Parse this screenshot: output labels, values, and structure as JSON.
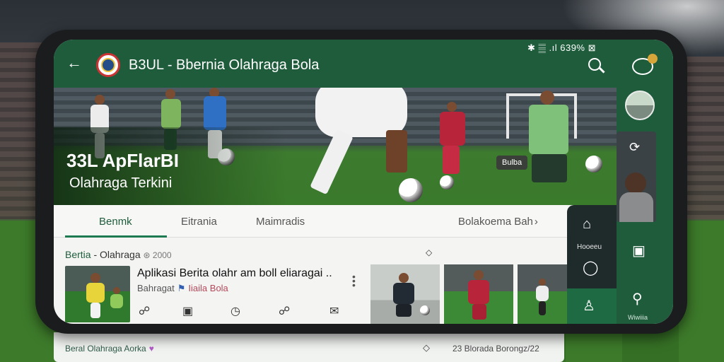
{
  "status_bar": {
    "text": "✱ 𝄛 .ıl 639% ⊠"
  },
  "app_bar": {
    "title": "B3UL - Bbernia Olahraga Bola"
  },
  "hero": {
    "title": "33L ApFlarBI",
    "subtitle": "Olahraga Terkini",
    "badge": "Bulba"
  },
  "tabs": [
    {
      "label": "Benmk",
      "active": true
    },
    {
      "label": "Eitrania",
      "active": false
    },
    {
      "label": "Maimradis",
      "active": false
    },
    {
      "label": "Bolakoema Bah",
      "active": false
    }
  ],
  "news": {
    "section_title": "Bertia",
    "section_subtitle": "- Olahraga",
    "section_count": "2000",
    "item": {
      "title": "Aplikasi Berita olahr am boll eliaragai ..",
      "source_prefix": "Bahragat",
      "source": "Iiaila Bola"
    }
  },
  "floating_menu": {
    "label": "Hooeeu"
  },
  "rail": {
    "label": "Wiwiiia"
  },
  "below_card": {
    "left_text": "Beral Olahraga Aorka",
    "right_text": "23 Blorada Borongz/22"
  },
  "colors": {
    "primary": "#1e5c3c",
    "accent": "#1e7a50",
    "menu_dark": "#1f2a2b"
  },
  "icons": [
    "back-icon",
    "search-icon",
    "chat-icon",
    "share-icon",
    "comment-icon",
    "profile-icon",
    "bookmark-icon",
    "pin-icon"
  ]
}
